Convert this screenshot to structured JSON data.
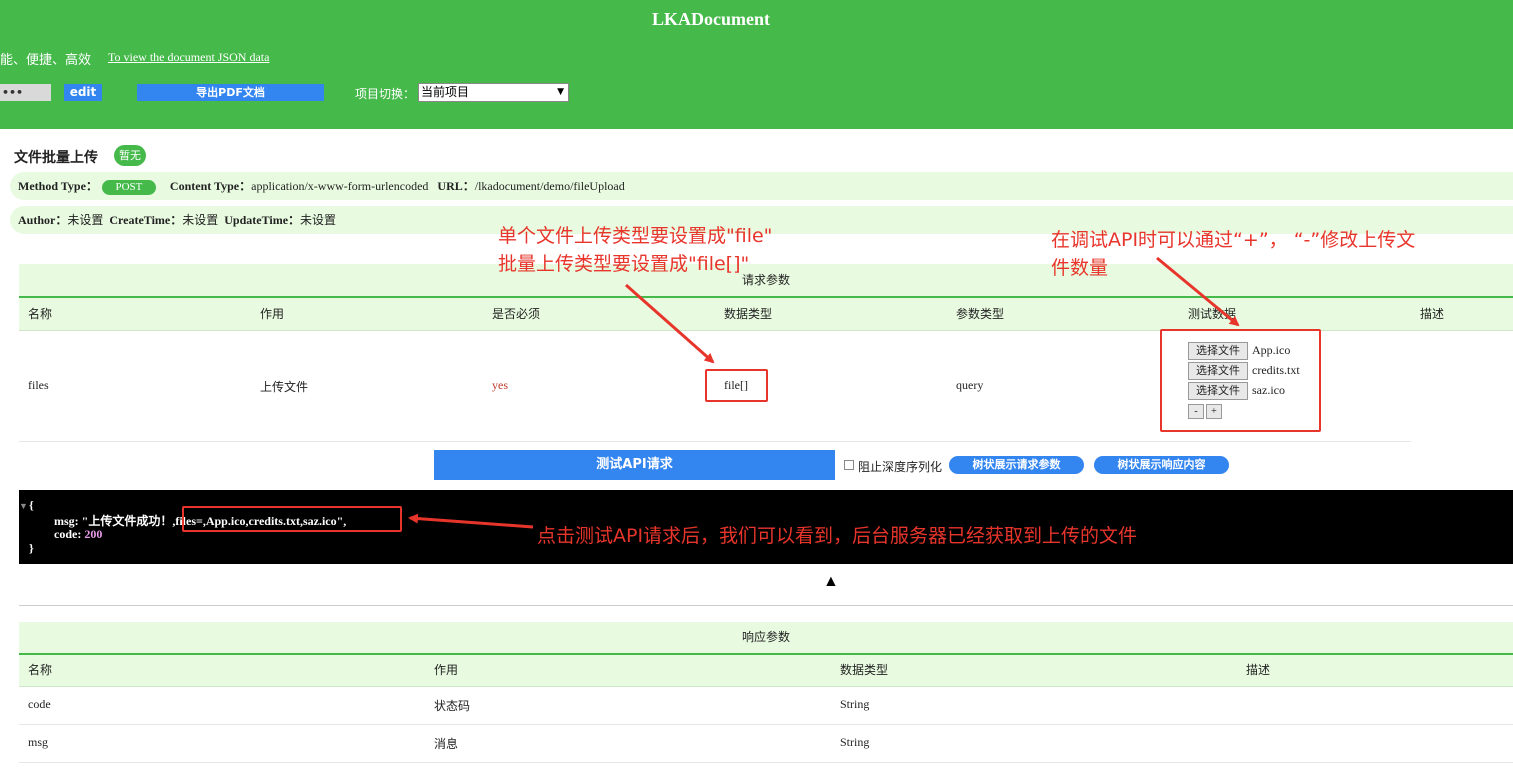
{
  "header": {
    "title": "LKADocument",
    "tagline": "能、便捷、高效",
    "json_link": "To view the document JSON data",
    "dots_label": "•••",
    "edit_label": "edit",
    "pdf_label": "导出PDF文档",
    "project_label": "项目切换：",
    "project_value": "当前项目",
    "bg_color": "#46b94b"
  },
  "api": {
    "name": "文件批量上传",
    "badge": "暂无",
    "method_label": "Method Type：",
    "method": "POST",
    "content_type_label": "Content Type：",
    "content_type": "application/x-www-form-urlencoded",
    "url_label": "URL：",
    "url": "/lkadocument/demo/fileUpload",
    "author_label": "Author：",
    "author": "未设置",
    "create_label": "CreateTime：",
    "create": "未设置",
    "update_label": "UpdateTime：",
    "update": "未设置"
  },
  "request": {
    "title": "请求参数",
    "columns": [
      "名称",
      "作用",
      "是否必须",
      "数据类型",
      "参数类型",
      "测试数据",
      "描述"
    ],
    "row": {
      "name": "files",
      "purpose": "上传文件",
      "required": "yes",
      "data_type": "file[]",
      "param_type": "query"
    },
    "file_button": "选择文件",
    "files": [
      "App.ico",
      "credits.txt",
      "saz.ico"
    ],
    "minus": "-",
    "plus": "+"
  },
  "actions": {
    "test_button": "测试API请求",
    "no_deep_serialize": "阻止深度序列化",
    "tree_request": "树状展示请求参数",
    "tree_response": "树状展示响应内容"
  },
  "result": {
    "open": "{",
    "msg_key": "msg: ",
    "msg_start": "\"上传文件成功！",
    "msg_files": ",files=,App.ico,credits.txt,saz.ico\",",
    "code_line": "code: ",
    "code_value": "200",
    "close": "}",
    "collapse_icon": "▲"
  },
  "response": {
    "title": "响应参数",
    "columns": [
      "名称",
      "作用",
      "数据类型",
      "描述"
    ],
    "rows": [
      {
        "name": "code",
        "purpose": "状态码",
        "type": "String"
      },
      {
        "name": "msg",
        "purpose": "消息",
        "type": "String"
      }
    ]
  },
  "annotations": {
    "a1_line1": "单个文件上传类型要设置成\"file\"",
    "a1_line2": "批量上传类型要设置成\"file[]\"",
    "a2_line1": "在调试API时可以通过“+”， “-”修改上传文",
    "a2_line2": "件数量",
    "a3": "点击测试API请求后，我们可以看到，后台服务器已经获取到上传的文件",
    "color": "#e8352b"
  }
}
